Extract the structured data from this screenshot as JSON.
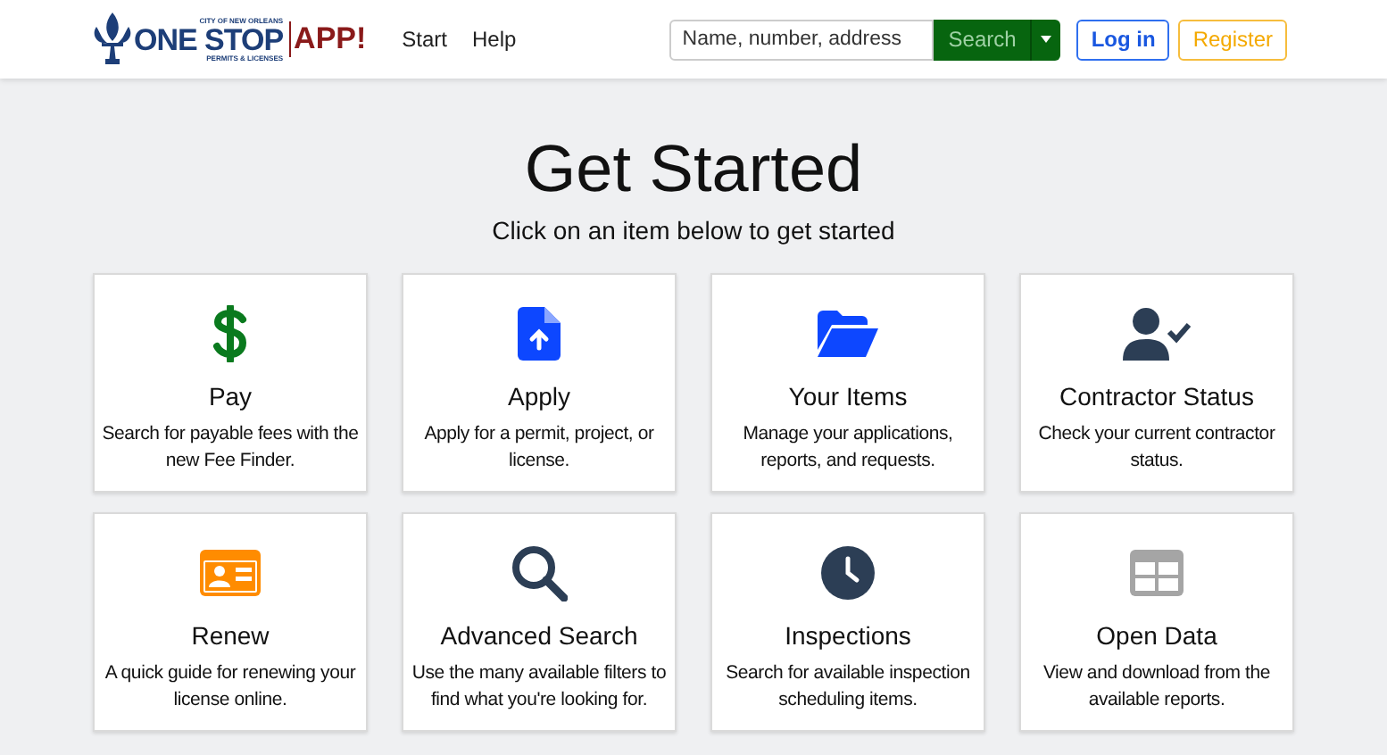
{
  "logo": {
    "top": "CITY OF NEW ORLEANS",
    "main": "ONE STOP",
    "sub": "PERMITS & LICENSES",
    "app": "APP!"
  },
  "nav": [
    {
      "label": "Start"
    },
    {
      "label": "Help"
    }
  ],
  "search": {
    "placeholder": "Name, number, address",
    "button": "Search"
  },
  "auth": {
    "login": "Log in",
    "register": "Register"
  },
  "heading": "Get Started",
  "subheading": "Click on an item below to get started",
  "cards": [
    {
      "kind": "dollar",
      "title": "Pay",
      "text": "Search for payable fees with the new Fee Finder."
    },
    {
      "kind": "file-upload",
      "title": "Apply",
      "text": "Apply for a permit, project, or license."
    },
    {
      "kind": "folder",
      "title": "Your Items",
      "text": "Manage your applications, reports, and requests."
    },
    {
      "kind": "user-check",
      "title": "Contractor Status",
      "text": "Check your current contractor status."
    },
    {
      "kind": "id-card",
      "title": "Renew",
      "text": "A quick guide for renewing your license online."
    },
    {
      "kind": "search",
      "title": "Advanced Search",
      "text": "Use the many available filters to find what you're looking for."
    },
    {
      "kind": "clock",
      "title": "Inspections",
      "text": "Search for available inspection scheduling items."
    },
    {
      "kind": "table",
      "title": "Open Data",
      "text": "View and download from the available reports."
    }
  ]
}
